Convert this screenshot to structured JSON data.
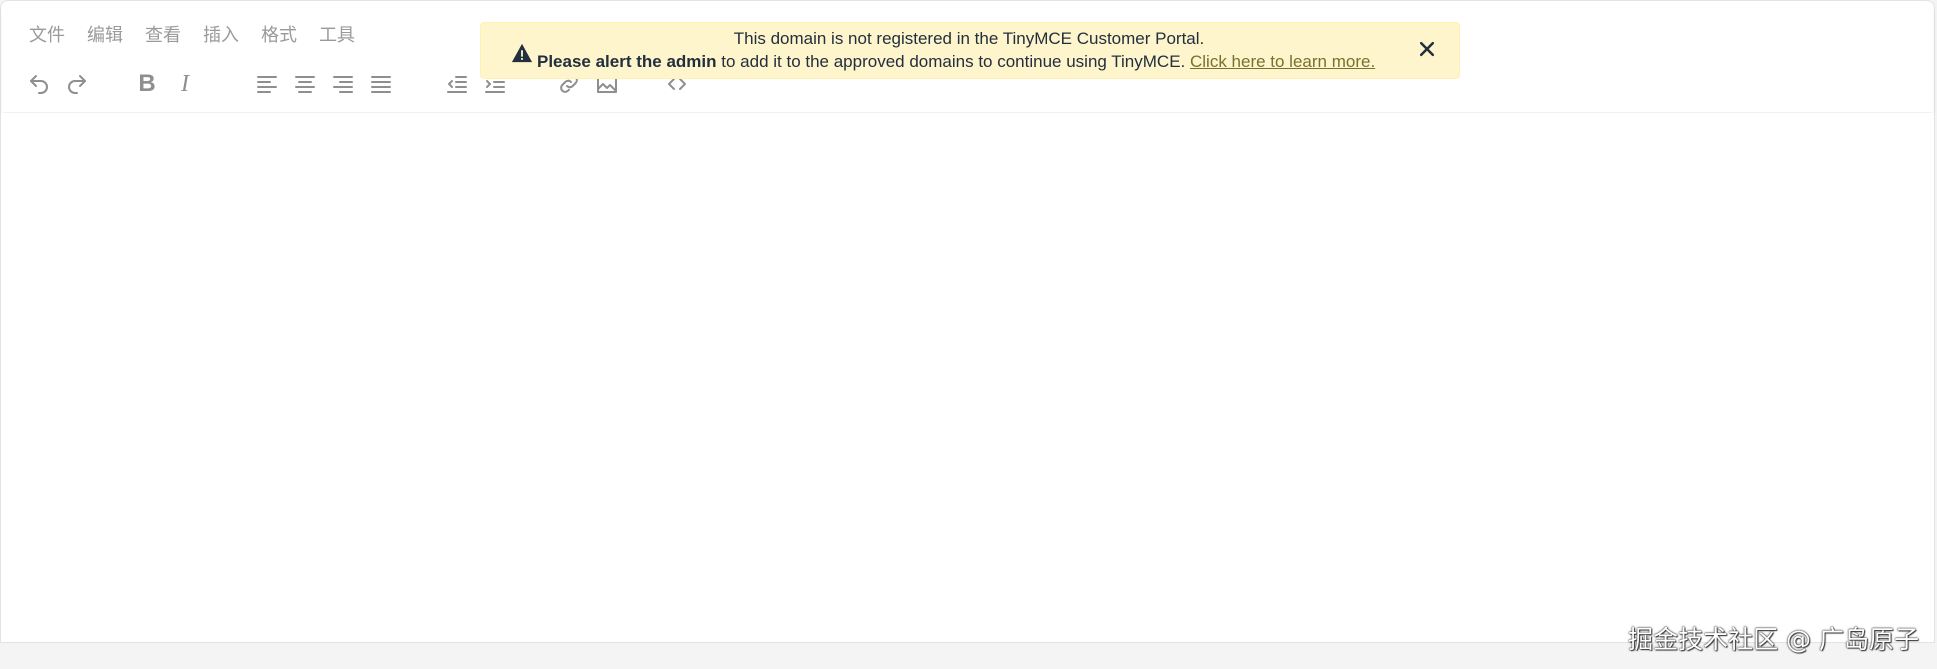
{
  "menubar": {
    "items": [
      "文件",
      "编辑",
      "查看",
      "插入",
      "格式",
      "工具"
    ]
  },
  "toolbar": {
    "bold_label": "B",
    "italic_label": "I",
    "icons": [
      "undo-icon",
      "redo-icon",
      "bold-icon",
      "italic-icon",
      "align-left-icon",
      "align-center-icon",
      "align-right-icon",
      "align-justify-icon",
      "outdent-icon",
      "indent-icon",
      "link-icon",
      "image-icon",
      "code-icon"
    ]
  },
  "notice": {
    "line1": "This domain is not registered in the TinyMCE Customer Portal.",
    "bold_text": "Please alert the admin",
    "rest_text": " to add it to the approved domains to continue using TinyMCE. ",
    "link_text": "Click here to learn more.",
    "background": "#fff5cc",
    "link_color": "#78712e"
  },
  "watermark": {
    "text": "掘金技术社区 @ 广岛原子"
  }
}
